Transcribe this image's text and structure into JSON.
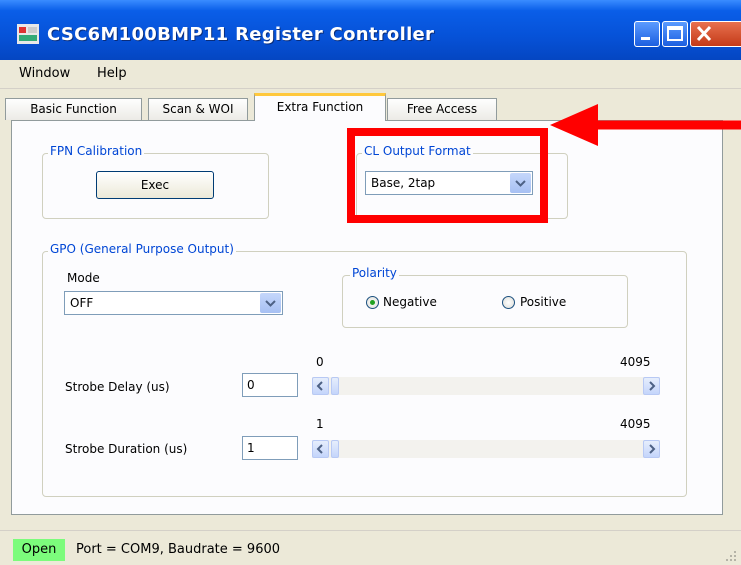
{
  "window": {
    "title": "CSC6M100BMP11 Register Controller",
    "controls": {
      "minimize": "minimize-icon",
      "maximize": "maximize-icon",
      "close": "close-icon"
    }
  },
  "menu": [
    "Window",
    "Help"
  ],
  "tabs": [
    {
      "label": "Basic Function",
      "active": false
    },
    {
      "label": "Scan & WOI",
      "active": false
    },
    {
      "label": "Extra Function",
      "active": true
    },
    {
      "label": "Free Access",
      "active": false
    }
  ],
  "fpn": {
    "group_label": "FPN Calibration",
    "exec_label": "Exec"
  },
  "cl_output": {
    "group_label": "CL Output Format",
    "selected": "Base, 2tap"
  },
  "gpo": {
    "group_label": "GPO (General Purpose Output)",
    "mode_label": "Mode",
    "mode_selected": "OFF",
    "polarity": {
      "group_label": "Polarity",
      "negative_label": "Negative",
      "positive_label": "Positive",
      "selected": "Negative"
    },
    "strobe_delay": {
      "label": "Strobe Delay (us)",
      "value": "0",
      "min": "0",
      "max": "4095"
    },
    "strobe_duration": {
      "label": "Strobe Duration (us)",
      "value": "1",
      "min": "1",
      "max": "4095"
    }
  },
  "status": {
    "state": "Open",
    "text": "Port = COM9,  Baudrate = 9600"
  },
  "colors": {
    "titlebar": "#0652d8",
    "group_label": "#0046d5",
    "status_open_bg": "#7cfc7c",
    "annotation": "#ff0000",
    "tab_highlight": "#ffc83c"
  }
}
